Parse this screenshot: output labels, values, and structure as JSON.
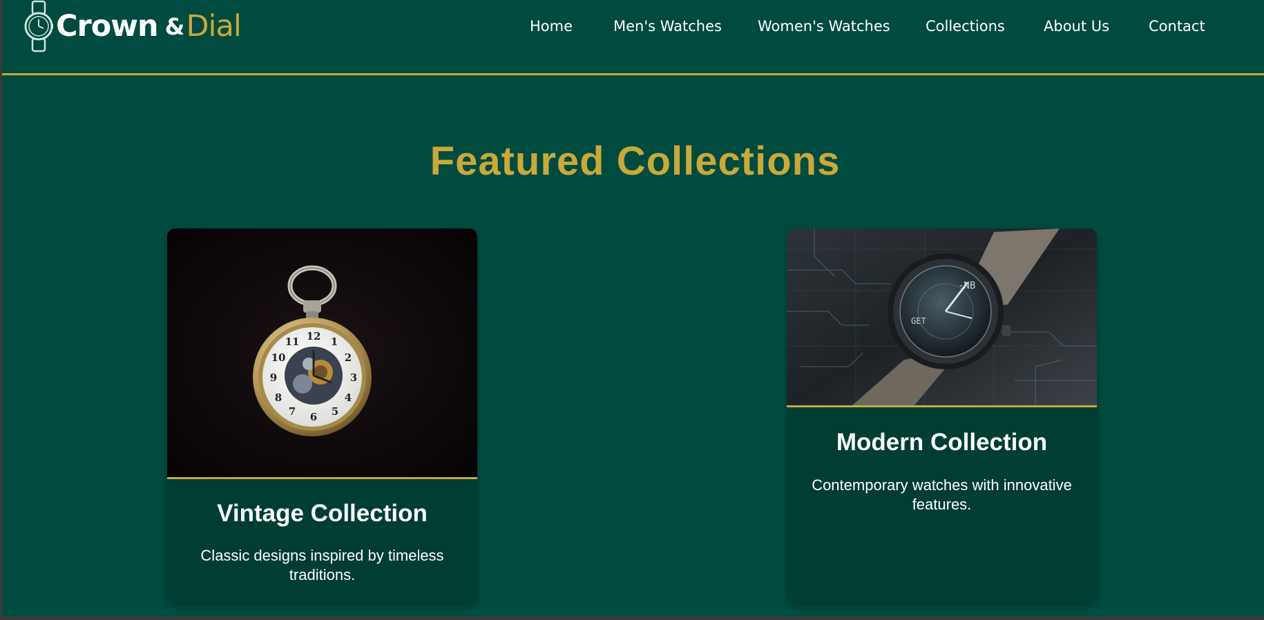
{
  "brand": {
    "name_part1": "Crown",
    "ampersand": "&",
    "name_part2": "Dial",
    "logo_icon": "wristwatch-icon"
  },
  "nav": {
    "items": [
      "Home",
      "Men's Watches",
      "Women's Watches",
      "Collections",
      "About Us",
      "Contact"
    ]
  },
  "featured": {
    "title": "Featured Collections",
    "cards": [
      {
        "title": "Vintage Collection",
        "description": "Classic designs inspired by timeless traditions.",
        "image": "pocket-watch-image"
      },
      {
        "title": "Modern Collection",
        "description": "Contemporary watches with innovative features.",
        "image": "smartwatch-image"
      }
    ]
  },
  "colors": {
    "background": "#004b3f",
    "card_background": "#003d33",
    "accent_gold": "#c9a93a",
    "text_white": "#ffffff"
  }
}
